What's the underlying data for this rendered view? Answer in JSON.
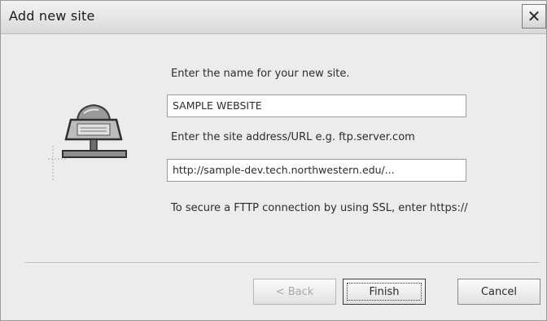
{
  "window": {
    "title": "Add new site",
    "close_glyph": "✕"
  },
  "form": {
    "name_prompt": "Enter the name for your new site.",
    "name_value": "SAMPLE WEBSITE",
    "url_prompt": "Enter the site address/URL e.g. ftp.server.com",
    "url_value": "http://sample-dev.tech.northwestern.edu/...",
    "note": "To secure a FTTP connection by using SSL, enter https://"
  },
  "buttons": {
    "back": "< Back",
    "finish": "Finish",
    "cancel": "Cancel"
  },
  "icons": {
    "site": "network-site-icon",
    "close": "close-icon"
  }
}
